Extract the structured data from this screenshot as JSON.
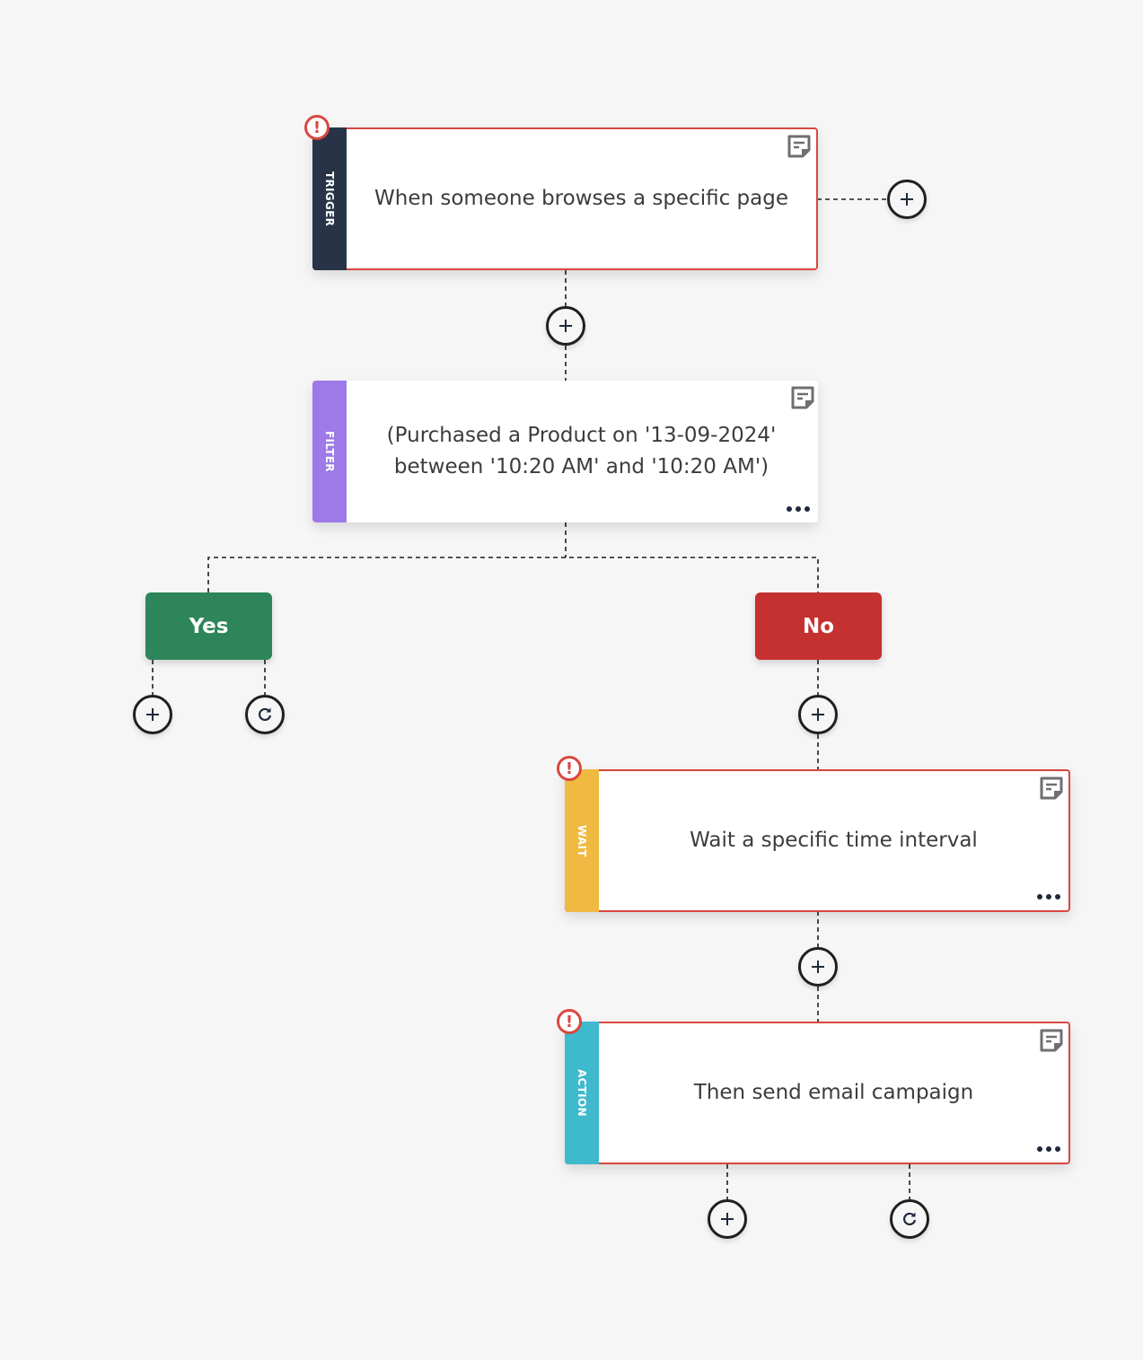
{
  "colors": {
    "background": "#f6f6f6",
    "error": "#d9473f",
    "trigger": "#283347",
    "filter": "#9d7ae8",
    "wait": "#f0b942",
    "action": "#3fb9cc",
    "yes": "#2e855a",
    "no": "#c53030"
  },
  "nodes": {
    "trigger": {
      "type_label": "TRIGGER",
      "text": "When someone browses a specific page",
      "has_error": true
    },
    "filter": {
      "type_label": "FILTER",
      "text": "(Purchased a Product on '13-09-2024' between '10:20 AM' and '10:20 AM')",
      "has_error": false
    },
    "wait": {
      "type_label": "WAIT",
      "text": "Wait a specific time interval",
      "has_error": true
    },
    "action": {
      "type_label": "ACTION",
      "text": "Then send email campaign",
      "has_error": true
    }
  },
  "branches": {
    "yes": {
      "label": "Yes"
    },
    "no": {
      "label": "No"
    }
  },
  "icons": {
    "error": "!",
    "add": "plus-icon",
    "loop": "refresh-icon",
    "note": "note-icon",
    "more": "more-icon"
  }
}
